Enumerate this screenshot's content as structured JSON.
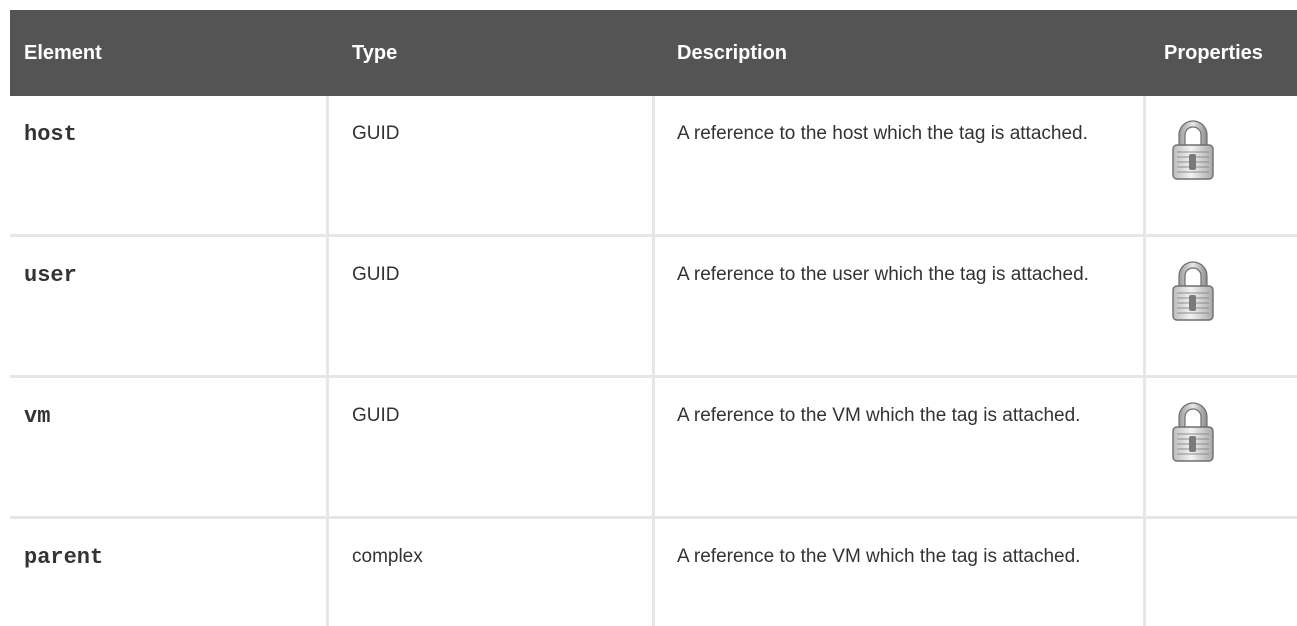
{
  "table": {
    "headers": {
      "element": "Element",
      "type": "Type",
      "description": "Description",
      "properties": "Properties"
    },
    "rows": [
      {
        "element": "host",
        "type": "GUID",
        "description": "A reference to the host which the tag is attached.",
        "properties_icon": "lock-icon"
      },
      {
        "element": "user",
        "type": "GUID",
        "description": "A reference to the user which the tag is attached.",
        "properties_icon": "lock-icon"
      },
      {
        "element": "vm",
        "type": "GUID",
        "description": "A reference to the VM which the tag is attached.",
        "properties_icon": "lock-icon"
      },
      {
        "element": "parent",
        "type": "complex",
        "description": "A reference to the VM which the tag is attached.",
        "properties_icon": ""
      }
    ]
  },
  "colors": {
    "header_bg": "#545454",
    "header_text": "#ffffff",
    "grid_line": "#e6e6e6",
    "body_text": "#333333"
  }
}
